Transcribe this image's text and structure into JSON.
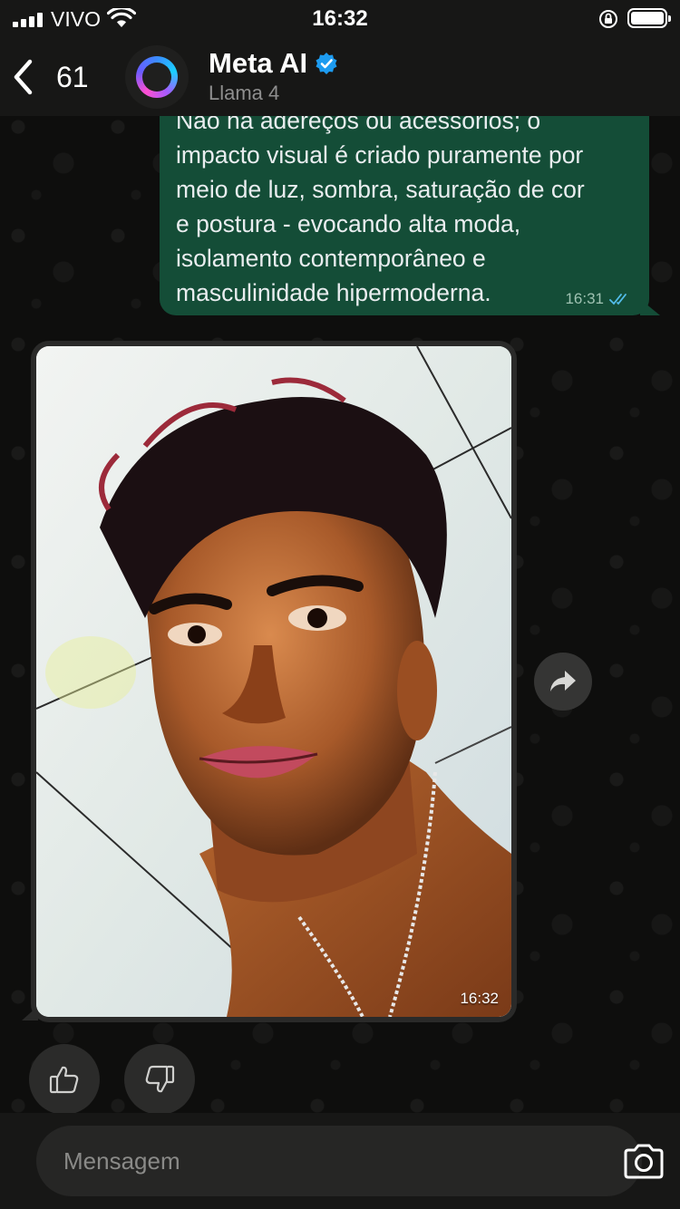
{
  "status_bar": {
    "carrier": "VIVO",
    "time": "16:32"
  },
  "header": {
    "back_count": "61",
    "contact_name": "Meta AI",
    "contact_subtitle": "Llama 4",
    "icons": [
      "chevron-left-icon",
      "meta-ai-avatar",
      "verified-badge-icon"
    ]
  },
  "messages": [
    {
      "type": "text",
      "direction": "outgoing",
      "text": "Não há adereços ou acessórios; o\nimpacto visual é criado puramente por\nmeio de luz, sombra, saturação de cor\ne postura - evocando alta moda,\nisolamento contemporâneo e\nmasculinidade hipermoderna.",
      "time": "16:31",
      "status": "read"
    },
    {
      "type": "image",
      "direction": "incoming",
      "time": "16:32"
    }
  ],
  "actions": {
    "icons": [
      "forward-icon",
      "thumbs-up-icon",
      "thumbs-down-icon"
    ]
  },
  "composer": {
    "placeholder": "Mensagem",
    "icons": [
      "camera-icon"
    ]
  },
  "colors": {
    "outgoing_bubble": "#144d37",
    "incoming_bubble": "#2a2a29",
    "header_bg": "#171716",
    "verified_blue": "#1d9bf0",
    "read_ticks": "#53bdeb"
  }
}
